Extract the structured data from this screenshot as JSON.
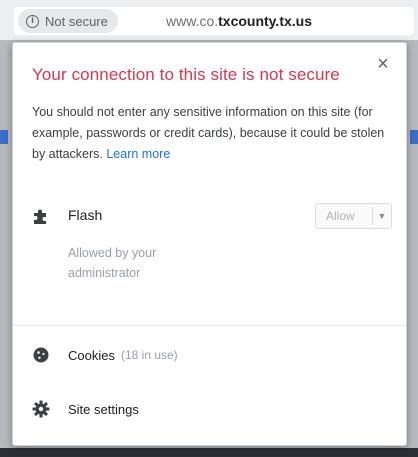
{
  "omnibox": {
    "security_label": "Not secure",
    "url_host": "www.co.",
    "url_rest": "txcounty.tx.us"
  },
  "popup": {
    "title": "Your connection to this site is not secure",
    "description": "You should not enter any sensitive information on this site (for example, passwords or credit cards), because it could be stolen by attackers.",
    "learn_more": "Learn more",
    "close_symbol": "×"
  },
  "permission": {
    "name": "Flash",
    "note": "Allowed by your administrator",
    "select_value": "Allow",
    "icon": "puzzle-icon"
  },
  "cookies": {
    "label": "Cookies",
    "usage": "(18 in use)",
    "icon": "cookie-icon"
  },
  "site_settings": {
    "label": "Site settings",
    "icon": "gear-icon"
  },
  "colors": {
    "title_red": "#d93652",
    "link_blue": "#1a73e8"
  }
}
